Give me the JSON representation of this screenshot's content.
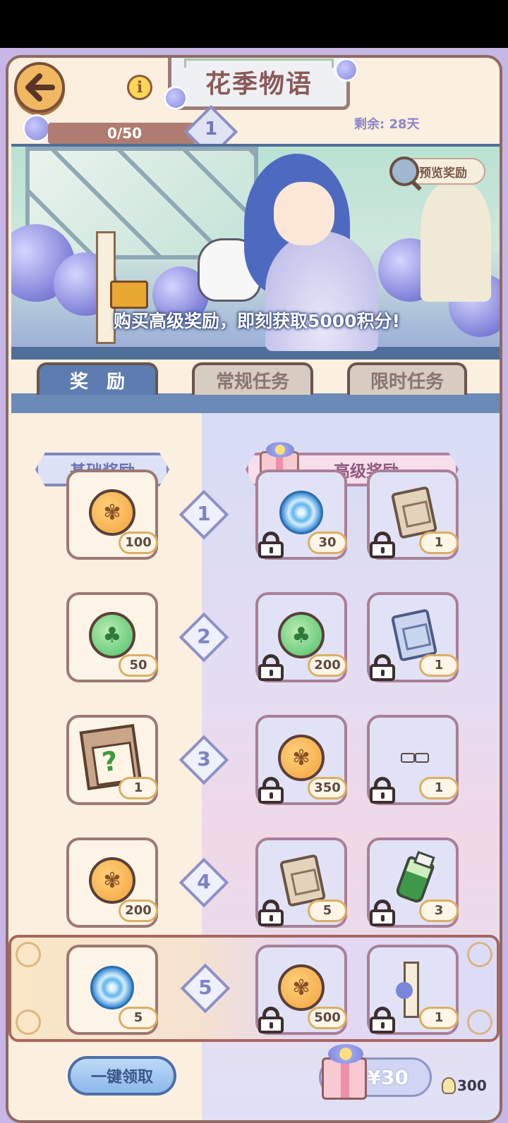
{
  "header": {
    "title": "花季物语",
    "back_icon": "arrow-left-icon",
    "info_icon": "info-icon",
    "progress": "0/50",
    "level": "1",
    "remaining_label": "剩余:",
    "remaining_value": "28天"
  },
  "banner": {
    "preview_label": "预览奖励",
    "promo_text": "购买高级奖励，即刻获取5000积分!"
  },
  "tabs": [
    {
      "label": "奖　励",
      "active": true
    },
    {
      "label": "常规任务",
      "active": false
    },
    {
      "label": "限时任务",
      "active": false
    }
  ],
  "columns": {
    "basic_label": "基础奖励",
    "advanced_label": "高级奖励"
  },
  "rows": [
    {
      "level": "1",
      "basic": {
        "icon": "orange-coin-icon",
        "qty": "100"
      },
      "adv1": {
        "icon": "blue-swirl-icon",
        "qty": "30"
      },
      "adv2": {
        "icon": "beige-scroll-icon",
        "qty": "1"
      }
    },
    {
      "level": "2",
      "basic": {
        "icon": "green-coin-icon",
        "qty": "50"
      },
      "adv1": {
        "icon": "green-coin-icon",
        "qty": "200"
      },
      "adv2": {
        "icon": "blue-scroll-icon",
        "qty": "1"
      }
    },
    {
      "level": "3",
      "basic": {
        "icon": "mystery-box-icon",
        "qty": "1"
      },
      "adv1": {
        "icon": "orange-coin-icon",
        "qty": "350"
      },
      "adv2": {
        "icon": "glasses-icon",
        "qty": "1"
      }
    },
    {
      "level": "4",
      "basic": {
        "icon": "orange-coin-icon",
        "qty": "200"
      },
      "adv1": {
        "icon": "beige-scroll-icon",
        "qty": "5"
      },
      "adv2": {
        "icon": "green-bottle-icon",
        "qty": "3"
      }
    },
    {
      "level": "5",
      "basic": {
        "icon": "blue-swirl-icon",
        "qty": "5"
      },
      "adv1": {
        "icon": "orange-coin-icon",
        "qty": "500"
      },
      "adv2": {
        "icon": "lamp-post-icon",
        "qty": "1"
      }
    }
  ],
  "footer": {
    "claim_all_label": "一键领取",
    "price_label": "¥30",
    "points": "300"
  }
}
